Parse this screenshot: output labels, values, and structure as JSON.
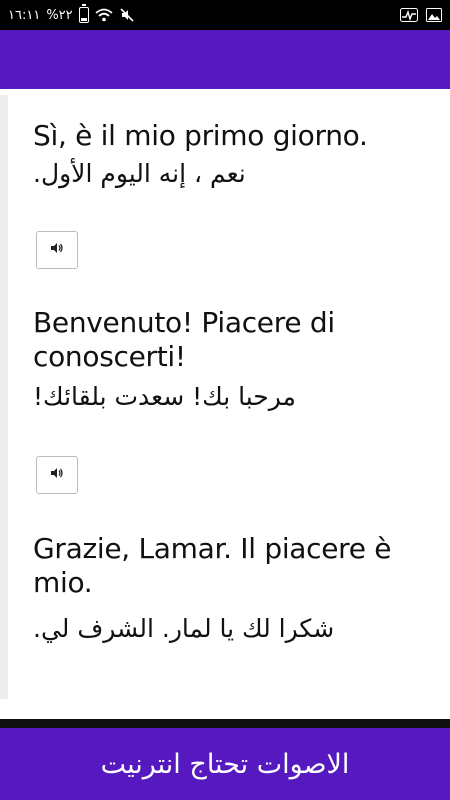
{
  "status_bar": {
    "time": "١٦:١١",
    "battery": "%٢٢",
    "icons": [
      "battery-icon",
      "wifi-icon",
      "mute-icon",
      "activity-icon",
      "image-icon"
    ]
  },
  "phrases": [
    {
      "italian": "Sì, è il mio primo giorno.",
      "arabic": "نعم ، إنه اليوم الأول.",
      "sound_icon": "speaker-icon"
    },
    {
      "italian": "Benvenuto! Piacere di conoscerti!",
      "arabic": "مرحبا بك! سعدت بلقائك!",
      "sound_icon": "speaker-icon"
    },
    {
      "italian": "Grazie, Lamar. Il piacere è mio.",
      "arabic": "شكرا لك يا لمار. الشرف لي."
    }
  ],
  "banner": {
    "text": "الاصوات تحتاج انترنيت"
  },
  "colors": {
    "primary": "#5519bf",
    "status_bar": "#000000",
    "background": "#ffffff"
  }
}
